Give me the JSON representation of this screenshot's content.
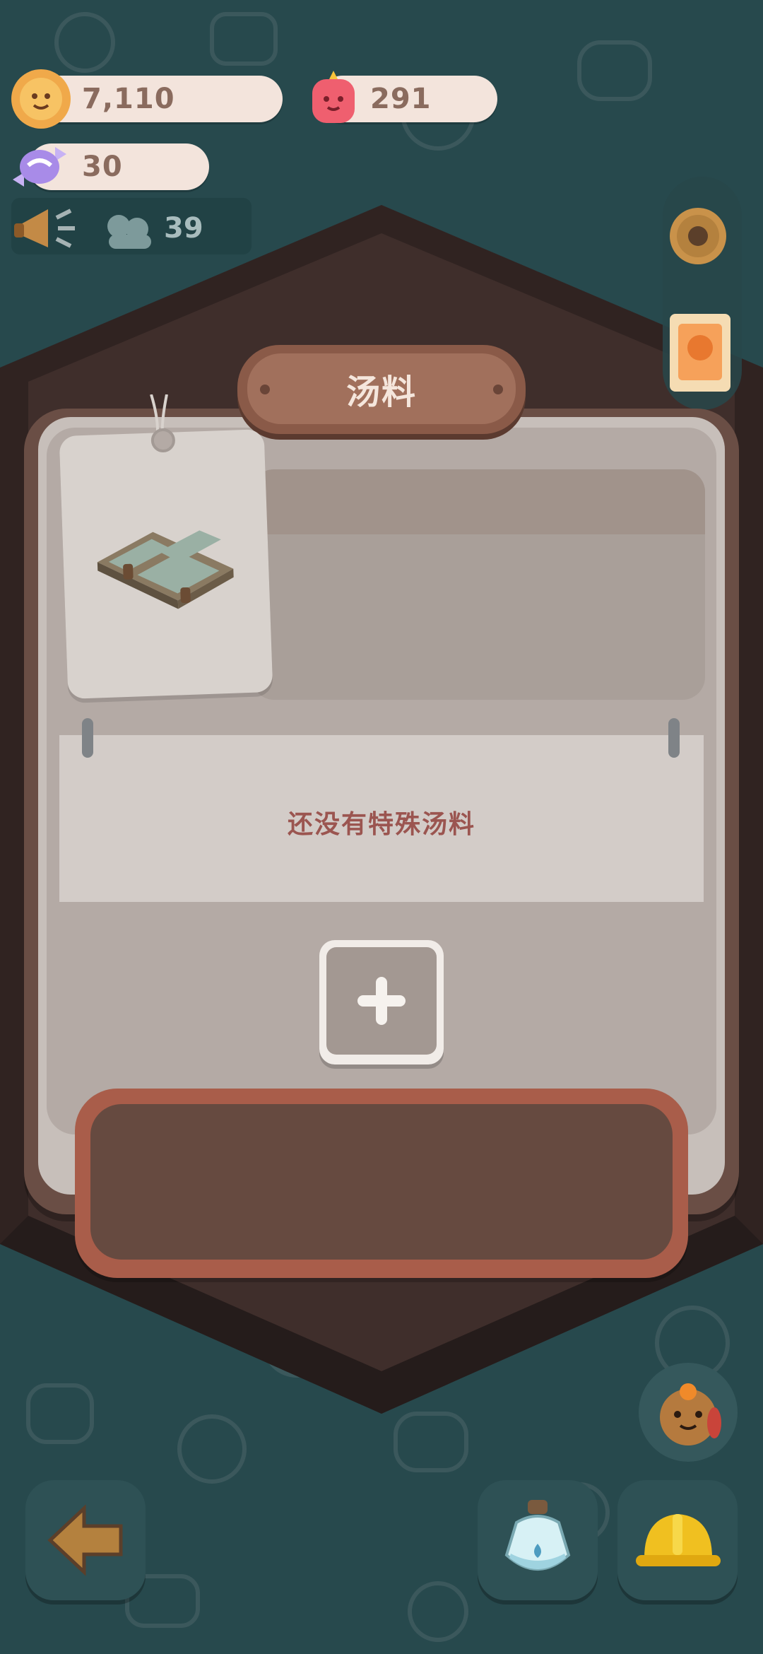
{
  "currencies": {
    "cookies": {
      "value": "7,110",
      "icon": "cookie-icon"
    },
    "gems": {
      "value": "291",
      "icon": "jelly-gem-icon"
    },
    "candy": {
      "value": "30",
      "icon": "candy-icon"
    }
  },
  "visitors": {
    "count": "39",
    "icon": "visitors-icon"
  },
  "dialog": {
    "title": "汤料",
    "empty_message": "还没有特殊汤料",
    "add_icon": "plus-icon"
  },
  "side_panel": {
    "items": [
      "settings-gear-icon",
      "stamp-icon"
    ]
  },
  "bottom_bar": {
    "items": [
      "back-arrow-icon",
      "potion-icon",
      "hard-hat-icon"
    ]
  },
  "colors": {
    "background": "#2f5a5f",
    "dialog_frame": "#6a4e45",
    "title_plate": "#a1705c",
    "empty_text": "#9b5550"
  }
}
